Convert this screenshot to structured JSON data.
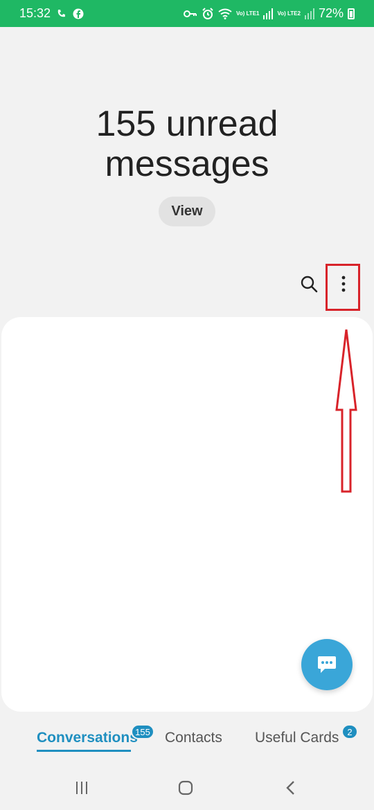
{
  "status_bar": {
    "time": "15:32",
    "battery": "72%",
    "lte1": "Vo) LTE1",
    "lte2": "Vo) LTE2",
    "icons": [
      "call-forward-icon",
      "facebook-icon",
      "vpn-key-icon",
      "alarm-icon",
      "wifi-icon",
      "signal-icon",
      "battery-icon"
    ]
  },
  "header": {
    "unread_line1": "155 unread",
    "unread_line2": "messages",
    "view_label": "View"
  },
  "toolbar": {
    "icons": [
      "search-icon",
      "more-vert-icon"
    ]
  },
  "annotation": {
    "color": "#d8232a"
  },
  "tabs": [
    {
      "label": "Conversations",
      "badge": "155",
      "active": true
    },
    {
      "label": "Contacts"
    },
    {
      "label": "Useful Cards",
      "badge": "2"
    }
  ],
  "colors": {
    "status_bar": "#1fb864",
    "accent": "#1f8fc0",
    "fab": "#3aa6d8",
    "background": "#f2f2f2"
  },
  "navigation": {
    "icons": [
      "recents-icon",
      "home-icon",
      "back-icon"
    ]
  }
}
